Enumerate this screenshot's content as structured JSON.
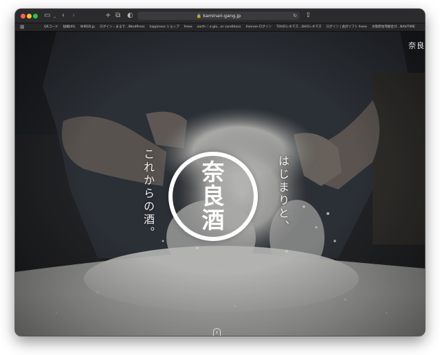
{
  "browser": {
    "url": "kaminari-gang.jp",
    "bookmarks": [
      "QRコード",
      "短縮URL",
      "WIRED.jp",
      "ログイン ‹ まるで…WordPress",
      "happiness ショップ",
      "freee",
      "earth :: a glo…er conditions",
      "Xserver-ログイン",
      "TOHOシネマズ…OHOシネマズ",
      "ログイン | 会計ソフト freee",
      "大阪府住宅総合ガ…NAVITIME"
    ]
  },
  "hero": {
    "top_right_text": "奈良",
    "left_vertical_text": "これからの酒。",
    "right_vertical_text": "はじまりと、",
    "logo_chars": [
      "奈",
      "良",
      "酒"
    ]
  },
  "colors": {
    "window_chrome": "#2b2b2d",
    "traffic_red": "#ff5f57",
    "traffic_yellow": "#febc2e",
    "traffic_green": "#28c840",
    "logo_white": "#ffffff"
  }
}
